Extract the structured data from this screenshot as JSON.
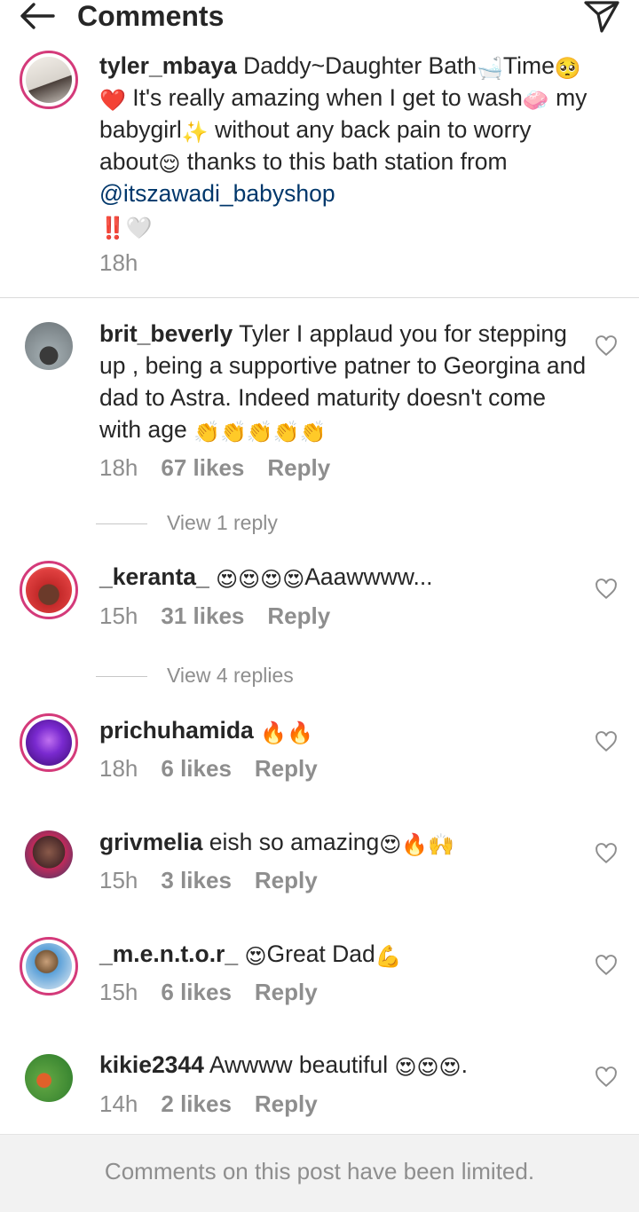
{
  "header": {
    "title": "Comments"
  },
  "post": {
    "username": "tyler_mbaya",
    "segments": [
      {
        "t": "Daddy~Daughter Bath"
      },
      {
        "e": "🛁"
      },
      {
        "t": "Time"
      },
      {
        "e": "🥺"
      },
      {
        "e": "❤️"
      },
      {
        "t": " It's really amazing when I get to wash"
      },
      {
        "e": "🧼"
      },
      {
        "t": " my babygirl"
      },
      {
        "e": "✨"
      },
      {
        "t": " without any back pain to worry about"
      },
      {
        "e": "😌"
      },
      {
        "t": " thanks to this bath station from "
      }
    ],
    "mention": "@itszawadi_babyshop",
    "trailing_emoji": "‼️🤍",
    "time": "18h"
  },
  "comments": [
    {
      "username": "brit_beverly",
      "text": "Tyler I applaud you for stepping up , being a supportive patner to Georgina and dad to Astra. Indeed maturity doesn't come with age",
      "emoji": "👏👏👏👏👏",
      "time": "18h",
      "likes": "67 likes",
      "reply": "Reply",
      "view_replies": "View 1 reply"
    },
    {
      "username": "_keranta_",
      "text": "",
      "emoji": "😍😍😍😍",
      "text_after": "Aaawwww...",
      "time": "15h",
      "likes": "31 likes",
      "reply": "Reply",
      "view_replies": "View 4 replies"
    },
    {
      "username": "prichuhamida",
      "text": "",
      "emoji": "🔥🔥",
      "time": "18h",
      "likes": "6 likes",
      "reply": "Reply"
    },
    {
      "username": "grivmelia",
      "text": "eish so amazing",
      "emoji": "😍🔥🙌",
      "time": "15h",
      "likes": "3 likes",
      "reply": "Reply"
    },
    {
      "username": "_m.e.n.t.o.r_",
      "text": "",
      "emoji": "😍",
      "text_after": "Great Dad",
      "emoji_after": "💪",
      "time": "15h",
      "likes": "6 likes",
      "reply": "Reply"
    },
    {
      "username": "kikie2344",
      "text": "Awwww beautiful",
      "emoji": "😍😍😍",
      "text_after": ".",
      "time": "14h",
      "likes": "2 likes",
      "reply": "Reply"
    }
  ],
  "footer": {
    "text": "Comments on this post have been limited."
  },
  "colors": {
    "text": "#262626",
    "muted": "#8e8e8e",
    "mention": "#00376b",
    "ring": "#d43a7a",
    "footer_bg": "#f2f2f2"
  },
  "icons": {
    "back": "arrow-left-icon",
    "share": "paper-plane-icon",
    "like": "heart-outline-icon"
  }
}
